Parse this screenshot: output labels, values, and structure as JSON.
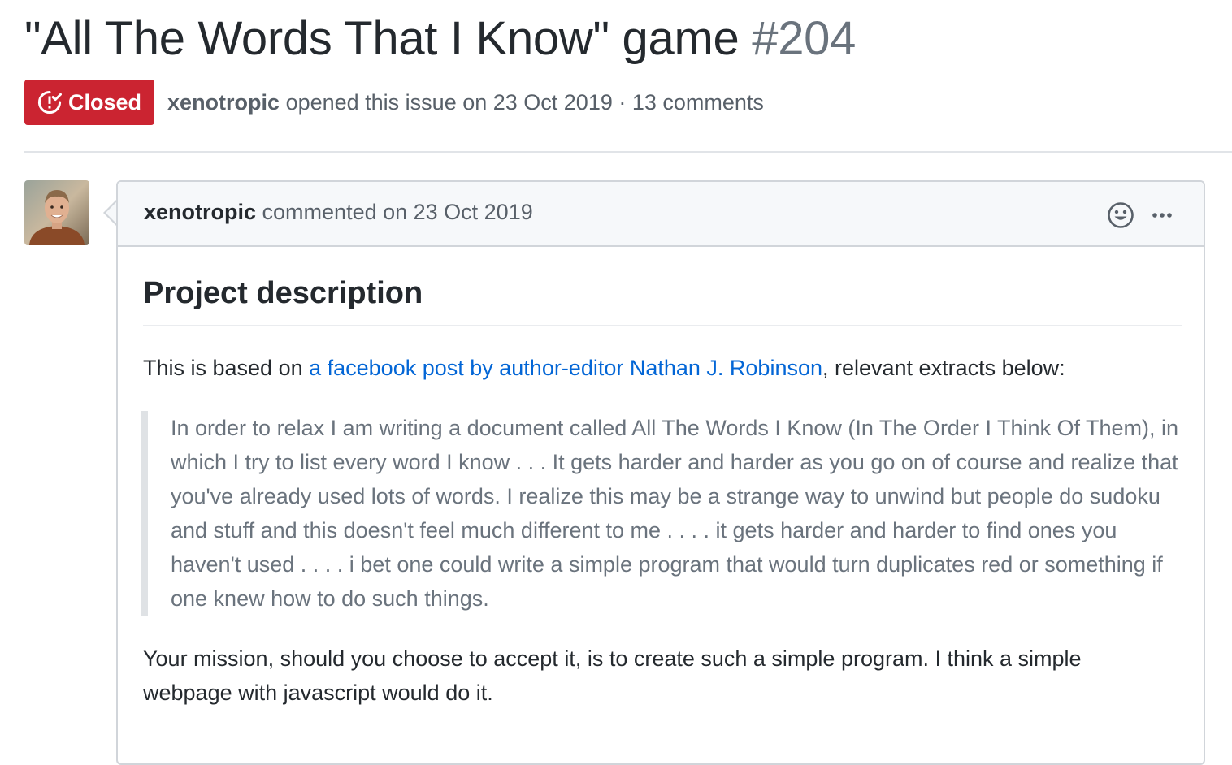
{
  "issue": {
    "title": "\"All The Words That I Know\" game",
    "number": "#204",
    "state_label": "Closed",
    "author": "xenotropic",
    "opened_text": " opened this issue on 23 Oct 2019 · 13 comments",
    "colors": {
      "closed": "#cb2431",
      "link": "#0366d6"
    }
  },
  "comment": {
    "author": "xenotropic",
    "meta": " commented on 23 Oct 2019",
    "avatar_icon": "user-photo",
    "reaction_icon": "smiley-icon",
    "menu_icon": "kebab-horizontal-icon",
    "heading": "Project description",
    "intro_before": "This is based on ",
    "intro_link": "a facebook post by author-editor Nathan J. Robinson",
    "intro_after": ", relevant extracts below:",
    "quote": "In order to relax I am writing a document called All The Words I Know (In The Order I Think Of Them), in which I try to list every word I know . . . It gets harder and harder as you go on of course and realize that you've already used lots of words. I realize this may be a strange way to unwind but people do sudoku and stuff and this doesn't feel much different to me . . . . it gets harder and harder to find ones you haven't used . . . . i bet one could write a simple program that would turn duplicates red or something if one knew how to do such things.",
    "mission": "Your mission, should you choose to accept it, is to create such a simple program. I think a simple webpage with javascript would do it."
  }
}
